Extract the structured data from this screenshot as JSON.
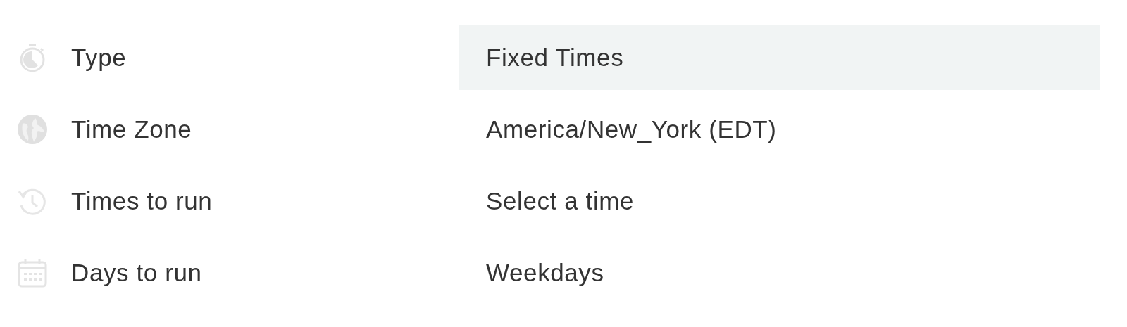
{
  "settings": [
    {
      "label": "Type",
      "value": "Fixed Times",
      "highlighted": true
    },
    {
      "label": "Time Zone",
      "value": "America/New_York (EDT)",
      "highlighted": false
    },
    {
      "label": "Times to run",
      "value": "Select a time",
      "highlighted": false
    },
    {
      "label": "Days to run",
      "value": "Weekdays",
      "highlighted": false
    }
  ]
}
